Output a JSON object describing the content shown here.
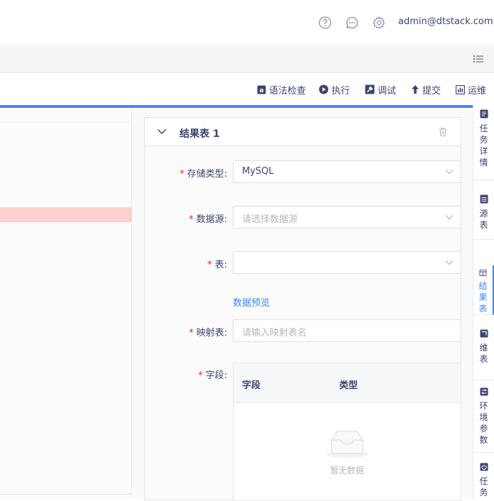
{
  "header": {
    "user": "admin@dtstack.com",
    "icons": [
      "help-icon",
      "message-icon",
      "settings-icon"
    ]
  },
  "toolbar": {
    "syntax_check": "语法检查",
    "run": "执行",
    "debug": "调试",
    "submit": "提交",
    "ops": "运维"
  },
  "panel": {
    "title": "结果表 1",
    "storage_type": {
      "label": "存储类型:",
      "value": "MySQL"
    },
    "datasource": {
      "label": "数据源:",
      "placeholder": "请选择数据源"
    },
    "table": {
      "label": "表:",
      "value": ""
    },
    "preview_link": "数据预览",
    "mapping": {
      "label": "映射表:",
      "placeholder": "请输入映射表名"
    },
    "fields": {
      "label": "字段:",
      "columns": [
        "字段",
        "类型"
      ],
      "empty_text": "暂无数据"
    }
  },
  "side_tabs": [
    {
      "label": "任务详情",
      "icon": "file-icon",
      "active": false
    },
    {
      "label": "源表",
      "icon": "table-icon",
      "active": false
    },
    {
      "label": "结果表",
      "icon": "result-table-icon",
      "active": true
    },
    {
      "label": "维表",
      "icon": "dim-table-icon",
      "active": false
    },
    {
      "label": "环境参数",
      "icon": "params-icon",
      "active": false
    },
    {
      "label": "任务",
      "icon": "power-icon",
      "active": false
    }
  ],
  "colors": {
    "accent": "#3f87f5",
    "required": "#f5222d",
    "error_line": "#fdd0d0"
  }
}
